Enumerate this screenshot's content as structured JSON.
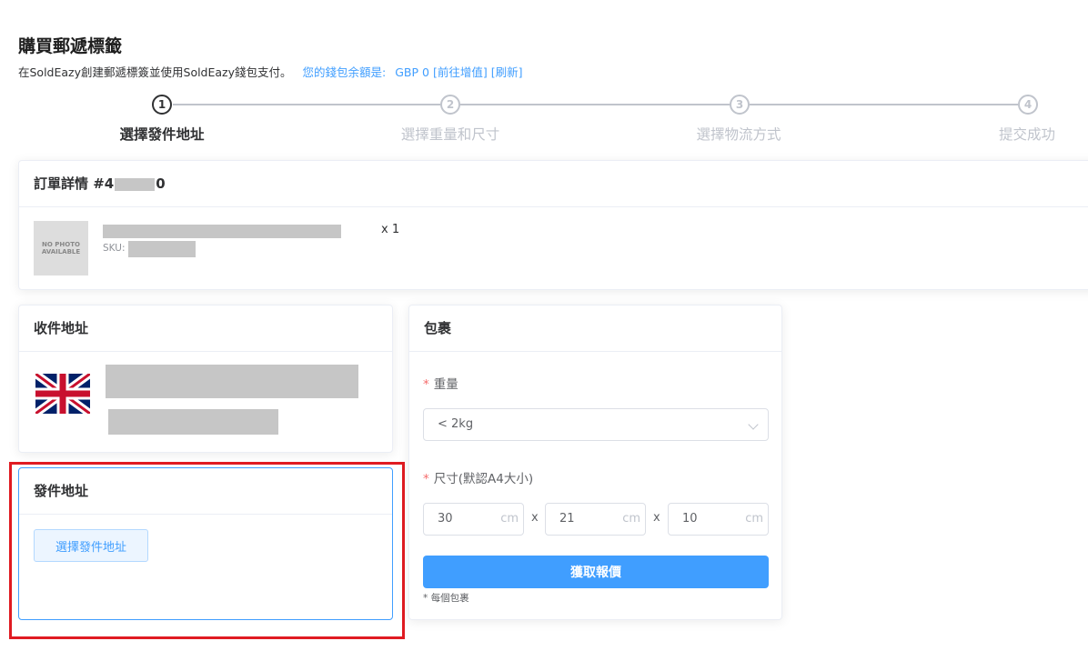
{
  "page": {
    "title": "購買郵遞標籤",
    "subtitle": "在SoldEazy創建郵遞標簽並使用SoldEazy錢包支付。",
    "wallet_label": "您的錢包余額是:",
    "wallet_balance": "GBP 0",
    "topup_link": "[前往增值]",
    "refresh_link": "[刷新]"
  },
  "steps": [
    {
      "num": "1",
      "label": "選擇發件地址",
      "active": true
    },
    {
      "num": "2",
      "label": "選擇重量和尺寸",
      "active": false
    },
    {
      "num": "3",
      "label": "選擇物流方式",
      "active": false
    },
    {
      "num": "4",
      "label": "提交成功",
      "active": false
    }
  ],
  "order": {
    "title_prefix": "訂單詳情 #4",
    "title_suffix": "0",
    "no_photo": "NO PHOTO AVAILABLE",
    "qty": "x 1",
    "sku_label": "SKU:"
  },
  "recipient": {
    "title": "收件地址",
    "flag_icon": "uk-flag-icon"
  },
  "sender": {
    "title": "發件地址",
    "choose_button": "選擇發件地址"
  },
  "package": {
    "title": "包裹",
    "weight_label": "重量",
    "weight_value": "< 2kg",
    "size_label": "尺寸(默認A4大小)",
    "length": "30",
    "width": "21",
    "height": "10",
    "unit": "cm",
    "times": "x",
    "quote_button": "獲取報價",
    "note": "* 每個包裹"
  },
  "colors": {
    "primary": "#409eff",
    "highlight": "#e01b22",
    "required": "#f56c6c"
  }
}
